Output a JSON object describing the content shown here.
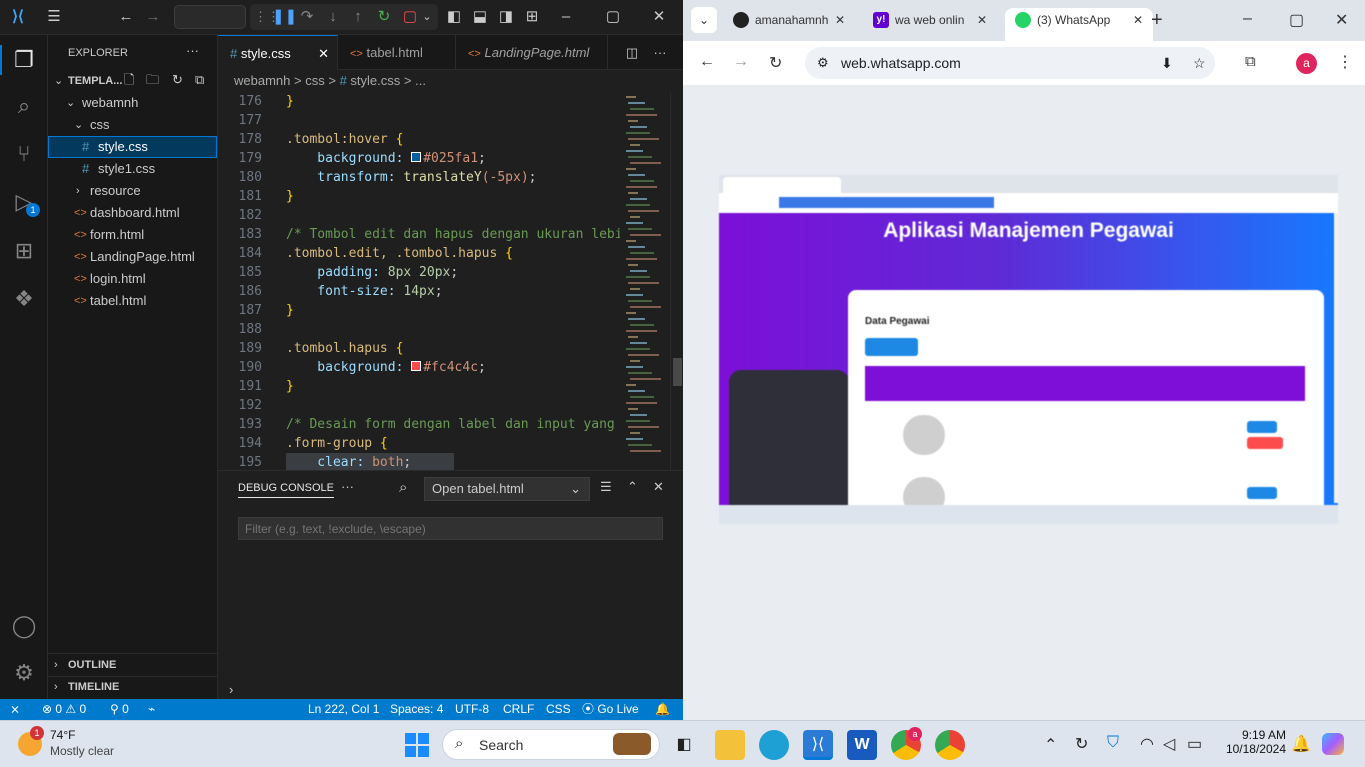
{
  "vscode": {
    "explorer": {
      "title": "EXPLORER",
      "workspace": "TEMPLA...",
      "folder": "webamnh",
      "subfolder": "css",
      "files_css": [
        "style.css",
        "style1.css"
      ],
      "folder_resource": "resource",
      "files": [
        "dashboard.html",
        "form.html",
        "LandingPage.html",
        "login.html",
        "tabel.html"
      ],
      "outline": "OUTLINE",
      "timeline": "TIMELINE"
    },
    "tabs": [
      {
        "label": "style.css",
        "icon": "#"
      },
      {
        "label": "tabel.html",
        "icon": "<>"
      },
      {
        "label": "LandingPage.html",
        "icon": "<>"
      }
    ],
    "breadcrumb": {
      "part1": "webamnh",
      "sep": ">",
      "part2": "css",
      "part3": "style.css",
      "part4": "..."
    },
    "code": {
      "line_numbers": [
        "176",
        "177",
        "178",
        "179",
        "180",
        "181",
        "182",
        "183",
        "184",
        "185",
        "186",
        "187",
        "188",
        "189",
        "190",
        "191",
        "192",
        "193",
        "194",
        "195"
      ],
      "l176": "}",
      "l178_sel": ".tombol:hover",
      "l178_brace": " {",
      "l179_prop": "    background: ",
      "l179_val": "#025fa1",
      "l179_end": ";",
      "l180_prop": "    transform: ",
      "l180_fn": "translateY",
      "l180_val": "(-5px)",
      "l180_end": ";",
      "l181": "}",
      "l183": "/* Tombol edit dan hapus dengan ukuran lebi",
      "l184_sel": ".tombol.edit, .tombol.hapus",
      "l184_brace": " {",
      "l185_prop": "    padding: ",
      "l185_val": "8px 20px",
      "l185_end": ";",
      "l186_prop": "    font-size: ",
      "l186_val": "14px",
      "l186_end": ";",
      "l187": "}",
      "l189_sel": ".tombol.hapus",
      "l189_brace": " {",
      "l190_prop": "    background: ",
      "l190_val": "#fc4c4c",
      "l190_end": ";",
      "l191": "}",
      "l193": "/* Desain form dengan label dan input yang",
      "l194_sel": ".form-group",
      "l194_brace": " {",
      "l195_prop": "    clear: ",
      "l195_val": "both",
      "l195_end": ";"
    },
    "panel": {
      "tab": "DEBUG CONSOLE",
      "dropdown": "Open tabel.html",
      "filter_placeholder": "Filter (e.g. text, !exclude, \\escape)"
    },
    "status": {
      "errors": "0",
      "warnings": "0",
      "ports": "0",
      "position": "Ln 222, Col 1",
      "spaces": "Spaces: 4",
      "encoding": "UTF-8",
      "eol": "CRLF",
      "lang": "CSS",
      "golive": "Go Live"
    }
  },
  "chrome": {
    "tabs": [
      "amanahamnh",
      "wa web onlin",
      "(3) WhatsApp"
    ],
    "url": "web.whatsapp.com",
    "profile_initial": "a",
    "preview": {
      "header": "Aplikasi Manajemen Pegawai",
      "card_title": "Data Pegawai"
    }
  },
  "taskbar": {
    "temp": "74°F",
    "weather": "Mostly clear",
    "search": "Search",
    "time": "9:19 AM",
    "date": "10/18/2024",
    "weather_badge": "1",
    "chrome_badge": "a"
  },
  "colors": {
    "vs_accent": "#007acc",
    "purple": "#7d0fd8",
    "tombol_hover": "#025fa1",
    "tombol_hapus": "#fc4c4c"
  }
}
